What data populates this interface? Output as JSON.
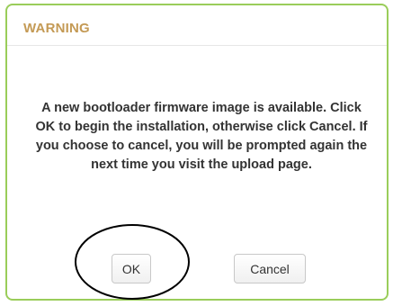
{
  "dialog": {
    "title": "WARNING",
    "message": "A new bootloader firmware image is available. Click OK to begin the installation, otherwise click Cancel. If you choose to cancel, you will be prompted again the next time you visit the upload page.",
    "ok_label": "OK",
    "cancel_label": "Cancel"
  },
  "colors": {
    "border": "#9acd5a",
    "title": "#c49a55",
    "text": "#333333",
    "annotation": "#000000"
  }
}
